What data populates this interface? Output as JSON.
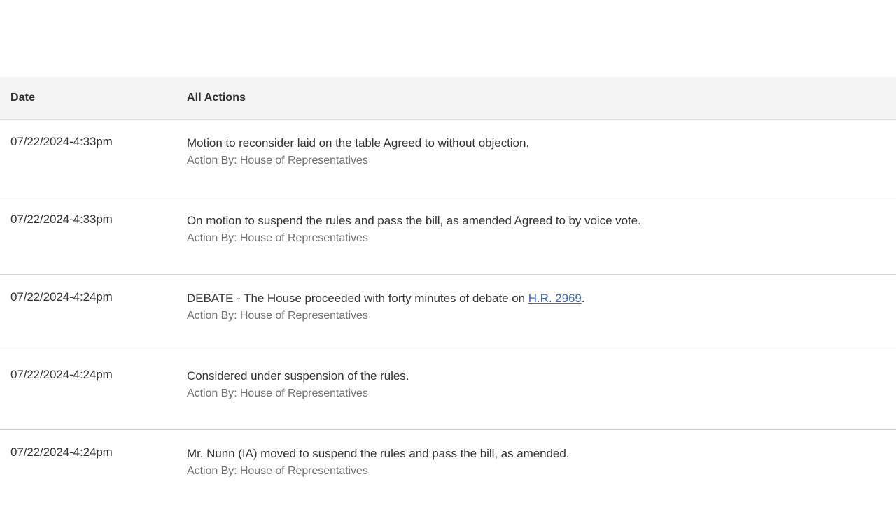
{
  "table": {
    "columns": [
      {
        "key": "date",
        "label": "Date"
      },
      {
        "key": "action",
        "label": "All Actions"
      }
    ],
    "header_background": "#f4f4f4",
    "row_divider_color": "#d4d4d4",
    "link_color": "#3b68c4",
    "action_by_color": "#707070",
    "rows": [
      {
        "date": "07/22/2024-4:33pm",
        "action_before_link": "Motion to reconsider laid on the table Agreed to without objection.",
        "link_text": "",
        "action_after_link": "",
        "action_by": "Action By: House of Representatives"
      },
      {
        "date": "07/22/2024-4:33pm",
        "action_before_link": "On motion to suspend the rules and pass the bill, as amended Agreed to by voice vote.",
        "link_text": "",
        "action_after_link": "",
        "action_by": "Action By: House of Representatives"
      },
      {
        "date": "07/22/2024-4:24pm",
        "action_before_link": "DEBATE - The House proceeded with forty minutes of debate on ",
        "link_text": "H.R. 2969",
        "action_after_link": ".",
        "action_by": "Action By: House of Representatives"
      },
      {
        "date": "07/22/2024-4:24pm",
        "action_before_link": "Considered under suspension of the rules.",
        "link_text": "",
        "action_after_link": "",
        "action_by": "Action By: House of Representatives"
      },
      {
        "date": "07/22/2024-4:24pm",
        "action_before_link": "Mr. Nunn (IA) moved to suspend the rules and pass the bill, as amended.",
        "link_text": "",
        "action_after_link": "",
        "action_by": "Action By: House of Representatives"
      }
    ]
  }
}
